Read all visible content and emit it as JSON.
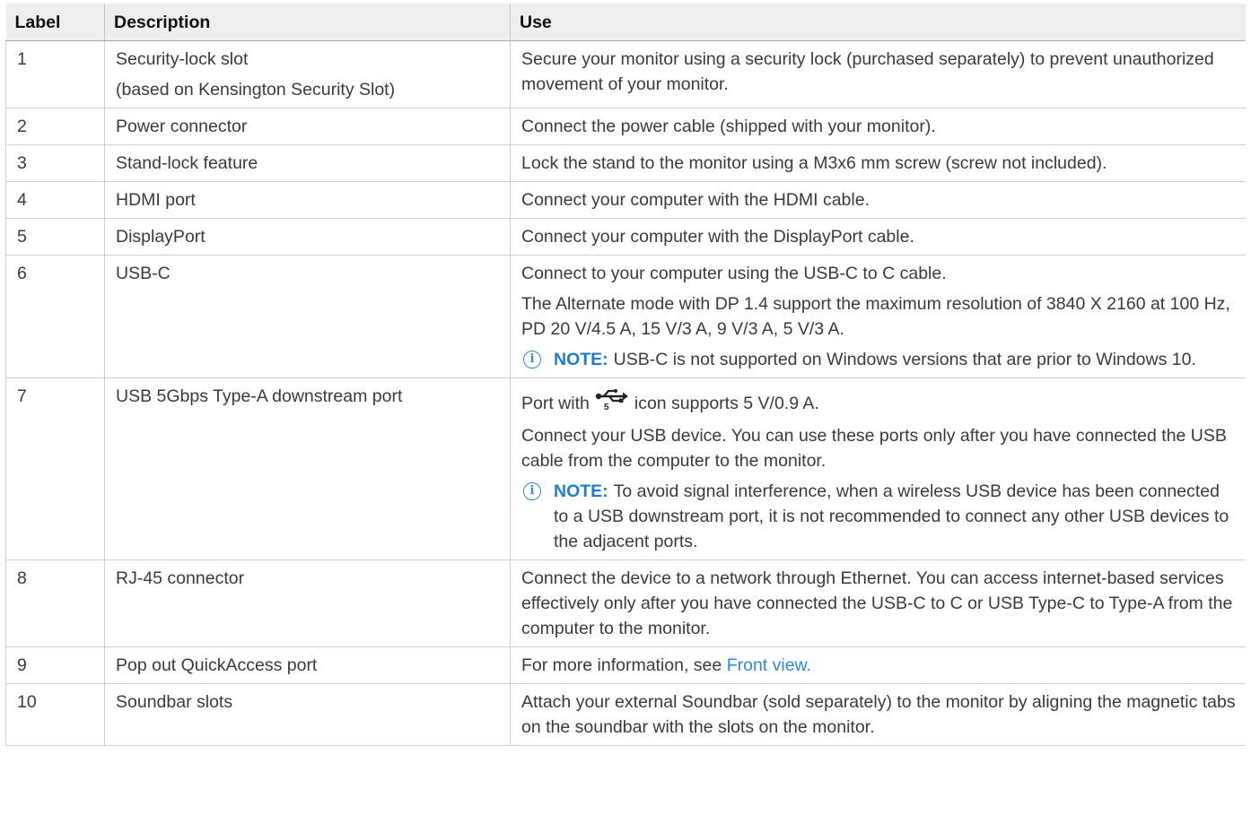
{
  "table": {
    "headers": {
      "label": "Label",
      "description": "Description",
      "use": "Use"
    },
    "rows": [
      {
        "label": "1",
        "desc1": "Security-lock slot",
        "desc2": "(based on Kensington Security Slot)",
        "use1": "Secure your monitor using a security lock (purchased separately) to prevent unauthorized movement of your monitor."
      },
      {
        "label": "2",
        "desc1": "Power connector",
        "use1": "Connect the power cable (shipped with your monitor)."
      },
      {
        "label": "3",
        "desc1": "Stand-lock feature",
        "use1": "Lock the stand to the monitor using a M3x6 mm screw (screw not included)."
      },
      {
        "label": "4",
        "desc1": "HDMI port",
        "use1": "Connect your computer with the HDMI cable."
      },
      {
        "label": "5",
        "desc1": "DisplayPort",
        "use1": "Connect your computer with the DisplayPort cable."
      },
      {
        "label": "6",
        "desc1": "USB-C",
        "use1": "Connect to your computer using the USB-C to C cable.",
        "use2": "The Alternate mode with DP 1.4 support the maximum resolution of 3840 X 2160 at 100 Hz, PD 20 V/4.5 A, 15 V/3 A, 9 V/3 A, 5 V/3 A.",
        "note_label": "NOTE:",
        "note_text": "USB-C is not supported on Windows versions that are prior to Windows 10."
      },
      {
        "label": "7",
        "desc1": "USB 5Gbps Type-A downstream port",
        "use1_pre": "Port with",
        "use1_icon_text": "5",
        "use1_post": "icon supports 5 V/0.9 A.",
        "use2": "Connect your USB device. You can use these ports only after you have connected the USB cable from the computer to the monitor.",
        "note_label": "NOTE:",
        "note_text": "To avoid signal interference, when a wireless USB device has been connected to a USB downstream port, it is not recommended to connect any other USB devices to the adjacent ports."
      },
      {
        "label": "8",
        "desc1": "RJ-45 connector",
        "use1": "Connect the device to a network through Ethernet. You can access internet-based services effectively only after you have connected the USB-C to C or USB Type-C to Type-A from the computer to the monitor."
      },
      {
        "label": "9",
        "desc1": "Pop out QuickAccess port",
        "use1_pre": "For more information, see",
        "use1_link": "Front view."
      },
      {
        "label": "10",
        "desc1": "Soundbar slots",
        "use1": "Attach your external Soundbar (sold separately) to the monitor by aligning the magnetic tabs on the soundbar with the slots on the monitor."
      }
    ]
  },
  "icons": {
    "info": "info-circle-icon",
    "usb": "usb-icon"
  },
  "colors": {
    "link": "#2e8bd6",
    "note_label": "#1e7ccf",
    "header_bg": "#eeeeee"
  }
}
